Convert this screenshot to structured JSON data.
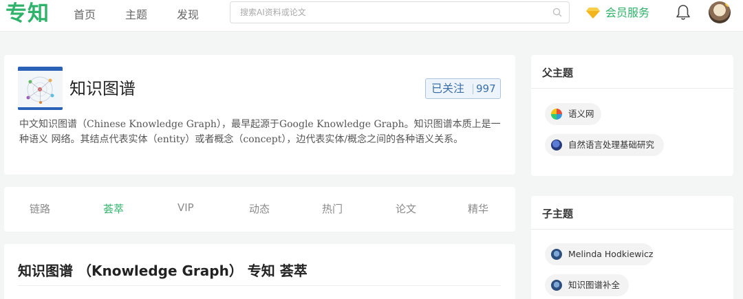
{
  "header": {
    "logo": "专知",
    "nav": [
      "首页",
      "主题",
      "发现"
    ],
    "search_placeholder": "搜索AI资料或论文",
    "vip_label": "会员服务"
  },
  "topic": {
    "title": "知识图谱",
    "follow_label": "已关注",
    "follow_count": "997",
    "description": "中文知识图谱（Chinese Knowledge Graph），最早起源于Google Knowledge Graph。知识图谱本质上是一种语义 网络。其结点代表实体（entity）或者概念（concept），边代表实体/概念之间的各种语义关系。"
  },
  "tabs": [
    {
      "label": "链路",
      "active": false
    },
    {
      "label": "荟萃",
      "active": true
    },
    {
      "label": "VIP",
      "active": false
    },
    {
      "label": "动态",
      "active": false
    },
    {
      "label": "热门",
      "active": false
    },
    {
      "label": "论文",
      "active": false
    },
    {
      "label": "精华",
      "active": false
    }
  ],
  "article": {
    "title": "知识图谱 （Knowledge Graph） 专知 荟萃"
  },
  "parent_topics": {
    "title": "父主题",
    "items": [
      {
        "label": "语义网",
        "icon": "semantic-web-icon"
      },
      {
        "label": "自然语言处理基础研究",
        "icon": "nlp-icon"
      }
    ]
  },
  "child_topics": {
    "title": "子主题",
    "items": [
      {
        "label": "Melinda Hodkiewicz",
        "icon": "person-icon"
      },
      {
        "label": "知识图谱补全",
        "icon": "kg-completion-icon"
      }
    ]
  },
  "colors": {
    "brand": "#2fb36a",
    "follow_text": "#3b6fa8"
  }
}
